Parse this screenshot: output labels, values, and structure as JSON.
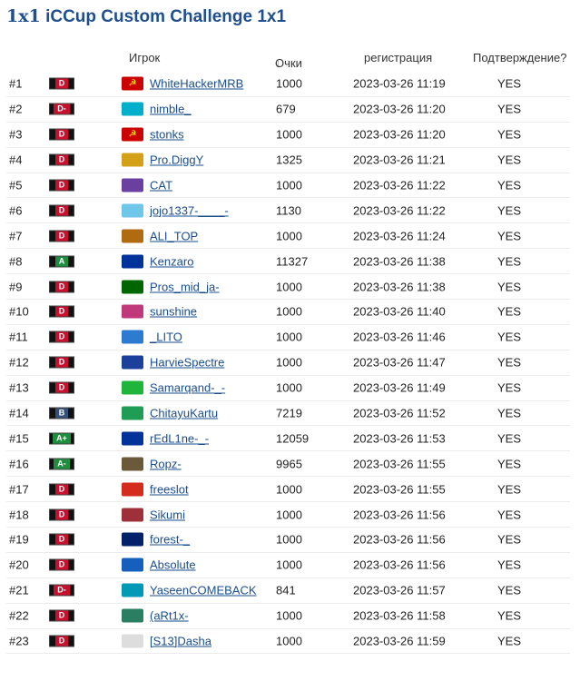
{
  "title": {
    "prefix": "1x1",
    "text": "iCCup Custom Challenge 1x1"
  },
  "table": {
    "headers": {
      "player": "Игрок",
      "points_arrow": "↓",
      "points": "Очки",
      "registration": "регистрация",
      "confirmation": "Подтверждение?"
    },
    "rows": [
      {
        "rank": "#1",
        "grade": "D",
        "name": "WhiteHackerMRB",
        "points": "1000",
        "date": "2023-03-26 11:19",
        "confirmed": "YES"
      },
      {
        "rank": "#2",
        "grade": "D-",
        "name": "nimble_",
        "points": "679",
        "date": "2023-03-26 11:20",
        "confirmed": "YES"
      },
      {
        "rank": "#3",
        "grade": "D",
        "name": "stonks",
        "points": "1000",
        "date": "2023-03-26 11:20",
        "confirmed": "YES"
      },
      {
        "rank": "#4",
        "grade": "D",
        "name": "Pro.DiggY",
        "points": "1325",
        "date": "2023-03-26 11:21",
        "confirmed": "YES"
      },
      {
        "rank": "#5",
        "grade": "D",
        "name": "CAT",
        "points": "1000",
        "date": "2023-03-26 11:22",
        "confirmed": "YES"
      },
      {
        "rank": "#6",
        "grade": "D",
        "name": "jojo1337-____-",
        "points": "1130",
        "date": "2023-03-26 11:22",
        "confirmed": "YES"
      },
      {
        "rank": "#7",
        "grade": "D",
        "name": "ALI_TOP",
        "points": "1000",
        "date": "2023-03-26 11:24",
        "confirmed": "YES"
      },
      {
        "rank": "#8",
        "grade": "A",
        "name": "Kenzaro",
        "points": "11327",
        "date": "2023-03-26 11:38",
        "confirmed": "YES"
      },
      {
        "rank": "#9",
        "grade": "D",
        "name": "Pros_mid_ja-",
        "points": "1000",
        "date": "2023-03-26 11:38",
        "confirmed": "YES"
      },
      {
        "rank": "#10",
        "grade": "D",
        "name": "sunshine",
        "points": "1000",
        "date": "2023-03-26 11:40",
        "confirmed": "YES"
      },
      {
        "rank": "#11",
        "grade": "D",
        "name": "_LITO",
        "points": "1000",
        "date": "2023-03-26 11:46",
        "confirmed": "YES"
      },
      {
        "rank": "#12",
        "grade": "D",
        "name": "HarvieSpectre",
        "points": "1000",
        "date": "2023-03-26 11:47",
        "confirmed": "YES"
      },
      {
        "rank": "#13",
        "grade": "D",
        "name": "Samarqand-_-",
        "points": "1000",
        "date": "2023-03-26 11:49",
        "confirmed": "YES"
      },
      {
        "rank": "#14",
        "grade": "B",
        "name": "ChitayuKartu",
        "points": "7219",
        "date": "2023-03-26 11:52",
        "confirmed": "YES"
      },
      {
        "rank": "#15",
        "grade": "A+",
        "name": "rEdL1ne-_-",
        "points": "12059",
        "date": "2023-03-26 11:53",
        "confirmed": "YES"
      },
      {
        "rank": "#16",
        "grade": "A-",
        "name": "Ropz-",
        "points": "9965",
        "date": "2023-03-26 11:55",
        "confirmed": "YES"
      },
      {
        "rank": "#17",
        "grade": "D",
        "name": "freeslot",
        "points": "1000",
        "date": "2023-03-26 11:55",
        "confirmed": "YES"
      },
      {
        "rank": "#18",
        "grade": "D",
        "name": "Sikumi",
        "points": "1000",
        "date": "2023-03-26 11:56",
        "confirmed": "YES"
      },
      {
        "rank": "#19",
        "grade": "D",
        "name": "forest-_",
        "points": "1000",
        "date": "2023-03-26 11:56",
        "confirmed": "YES"
      },
      {
        "rank": "#20",
        "grade": "D",
        "name": "Absolute",
        "points": "1000",
        "date": "2023-03-26 11:56",
        "confirmed": "YES"
      },
      {
        "rank": "#21",
        "grade": "D-",
        "name": "YaseenCOMEBACK",
        "points": "841",
        "date": "2023-03-26 11:57",
        "confirmed": "YES"
      },
      {
        "rank": "#22",
        "grade": "D",
        "name": "(aRt1x-",
        "points": "1000",
        "date": "2023-03-26 11:58",
        "confirmed": "YES"
      },
      {
        "rank": "#23",
        "grade": "D",
        "name": "[S13]Dasha",
        "points": "1000",
        "date": "2023-03-26 11:59",
        "confirmed": "YES"
      }
    ]
  },
  "grade_colors": {
    "D": "#c8102e",
    "D-": "#c8102e",
    "A": "#1e8e3e",
    "A+": "#1e8e3e",
    "A-": "#1e8e3e",
    "B": "#34507a"
  },
  "flags": [
    {
      "icon": "ussr-flag-icon",
      "bg": "#cc0000",
      "glyph": "☭"
    },
    {
      "icon": "kazakhstan-flag-icon",
      "bg": "#00afca",
      "glyph": ""
    },
    {
      "icon": "ussr-flag-icon",
      "bg": "#cc0000",
      "glyph": "☭"
    },
    {
      "icon": "clan-logo-icon",
      "bg": "#d4a017",
      "glyph": ""
    },
    {
      "icon": "purple-swirl-icon",
      "bg": "#6a3fa0",
      "glyph": ""
    },
    {
      "icon": "ghost-avatar-icon",
      "bg": "#6ec6e8",
      "glyph": ""
    },
    {
      "icon": "king-logo-icon",
      "bg": "#b06a10",
      "glyph": ""
    },
    {
      "icon": "eu-flag-icon",
      "bg": "#003399",
      "glyph": ""
    },
    {
      "icon": "portugal-flag-icon",
      "bg": "#006600",
      "glyph": ""
    },
    {
      "icon": "sunset-icon",
      "bg": "#c0397a",
      "glyph": ""
    },
    {
      "icon": "globe-icon",
      "bg": "#2d7bd1",
      "glyph": ""
    },
    {
      "icon": "russia-flag-icon",
      "bg": "#1c3f9a",
      "glyph": ""
    },
    {
      "icon": "uzbekistan-flag-icon",
      "bg": "#1eb53a",
      "glyph": ""
    },
    {
      "icon": "green-emblem-icon",
      "bg": "#1f9d55",
      "glyph": ""
    },
    {
      "icon": "eu-flag-icon",
      "bg": "#003399",
      "glyph": ""
    },
    {
      "icon": "ropz-logo-icon",
      "bg": "#6b5a3a",
      "glyph": ""
    },
    {
      "icon": "russia-flag-icon",
      "bg": "#d52b1e",
      "glyph": ""
    },
    {
      "icon": "latvia-flag-icon",
      "bg": "#9e3039",
      "glyph": ""
    },
    {
      "icon": "uk-flag-icon",
      "bg": "#012169",
      "glyph": ""
    },
    {
      "icon": "blue-emblem-icon",
      "bg": "#1560bd",
      "glyph": ""
    },
    {
      "icon": "uzbekistan-flag-icon",
      "bg": "#0099b5",
      "glyph": ""
    },
    {
      "icon": "green-logo-icon",
      "bg": "#2a7f62",
      "glyph": ""
    },
    {
      "icon": "cartoon-avatar-icon",
      "bg": "#dddddd",
      "glyph": ""
    }
  ]
}
